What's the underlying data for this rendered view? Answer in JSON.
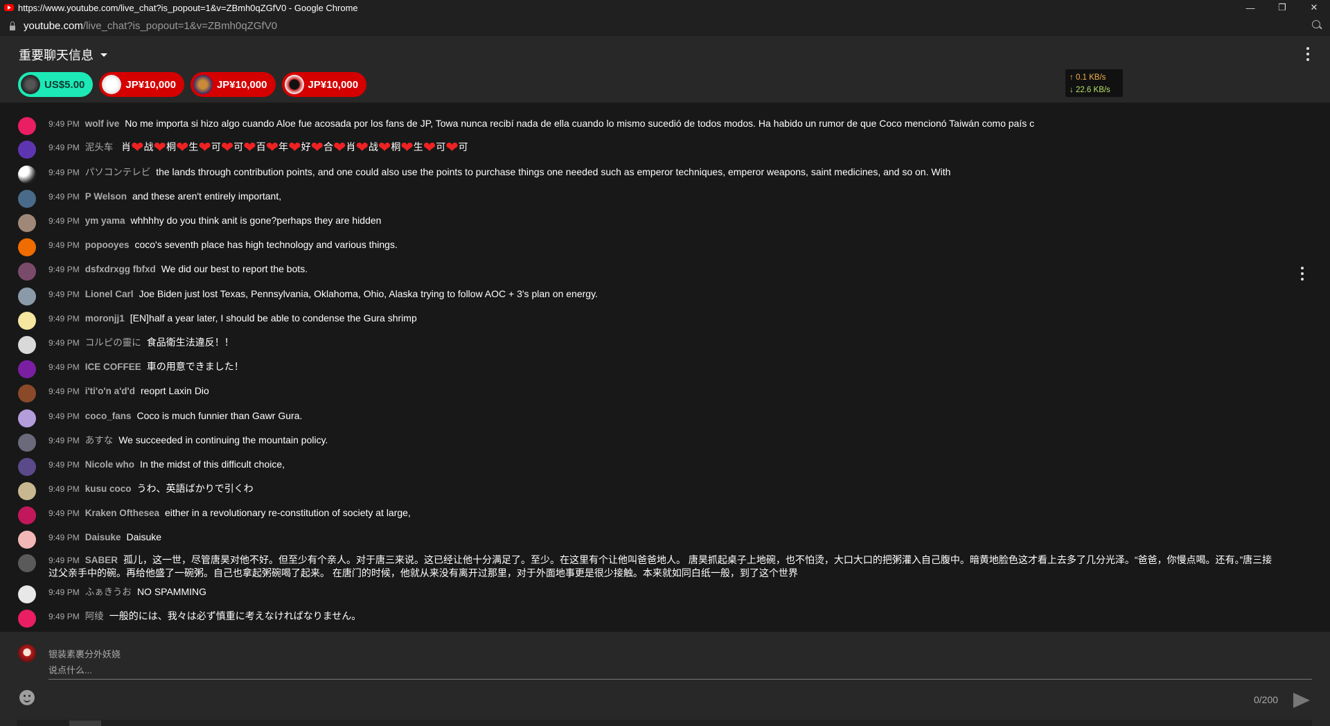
{
  "window": {
    "title": "https://www.youtube.com/live_chat?is_popout=1&v=ZBmh0qZGfV0 - Google Chrome",
    "url_host": "youtube.com",
    "url_path": "/live_chat?is_popout=1&v=ZBmh0qZGfV0",
    "controls": {
      "minimize": "—",
      "restore": "❐",
      "close": "✕"
    }
  },
  "network": {
    "up": "↑ 0.1 KB/s",
    "down": "↓ 22.6 KB/s"
  },
  "header": {
    "title": "重要聊天信息"
  },
  "tickers": [
    {
      "amount": "US$5.00",
      "color": "#1de9b6"
    },
    {
      "amount": "JP¥10,000",
      "color": "#d50000"
    },
    {
      "amount": "JP¥10,000",
      "color": "#d50000"
    },
    {
      "amount": "JP¥10,000",
      "color": "#d50000"
    }
  ],
  "messages": [
    {
      "time": "9:49 PM",
      "author": "wolf ive",
      "text": "No me importa si hizo algo cuando Aloe fue acosada por los fans de JP, Towa nunca recibí nada de ella cuando lo mismo sucedió de todos modos. Ha habido un rumor de que Coco mencionó Taiwán como país c",
      "avatar_color": "#e91e63"
    },
    {
      "time": "9:49 PM",
      "author": "泥头车",
      "text_parts": [
        "肖",
        "战",
        "桐",
        "生",
        "可",
        "可",
        "百",
        "年",
        "好",
        "合",
        "肖",
        "战",
        "桐",
        "生",
        "可",
        "可"
      ],
      "avatar_color": "#5e35b1"
    },
    {
      "time": "9:49 PM",
      "author": "パソコンテレビ",
      "text": "the lands through contribution points, and one could also use the points to purchase things one needed such as emperor techniques, emperor weapons, saint medicines, and so on. With",
      "avatar_color": "#eeeeee"
    },
    {
      "time": "9:49 PM",
      "author": "P Welson",
      "text": "and these aren't entirely important,",
      "avatar_color": "#4a6a8a"
    },
    {
      "time": "9:49 PM",
      "author": "ym yama",
      "text": "whhhhy do you think anit is gone?perhaps they are hidden",
      "avatar_color": "#a08878"
    },
    {
      "time": "9:49 PM",
      "author": "popooyes",
      "text": "coco's seventh place has high technology and various things.",
      "avatar_color": "#ef6c00"
    },
    {
      "time": "9:49 PM",
      "author": "dsfxdrxgg fbfxd",
      "text": "We did our best to report the bots.",
      "avatar_color": "#7a4a6a"
    },
    {
      "time": "9:49 PM",
      "author": "Lionel Carl",
      "text": "Joe Biden just lost Texas, Pennsylvania, Oklahoma, Ohio, Alaska trying to follow AOC + 3's plan on energy.",
      "avatar_color": "#8a9aa8"
    },
    {
      "time": "9:49 PM",
      "author": "moronjj1",
      "text": "[EN]half a year later, I should be able to condense the Gura shrimp",
      "avatar_color": "#f5e6a0"
    },
    {
      "time": "9:49 PM",
      "author": "コルピの靈に",
      "text": "食品衛生法違反！！",
      "avatar_color": "#d9d9d9"
    },
    {
      "time": "9:49 PM",
      "author": "ICE COFFEE",
      "text": "車の用意できました！",
      "avatar_color": "#7b1fa2"
    },
    {
      "time": "9:49 PM",
      "author": "i'ti'o'n a'd'd",
      "text": "reoprt Laxin Dio",
      "avatar_color": "#8a4a2a"
    },
    {
      "time": "9:49 PM",
      "author": "coco_fans",
      "text": "Coco is much funnier than Gawr Gura.",
      "avatar_color": "#b39ddb"
    },
    {
      "time": "9:49 PM",
      "author": "あすな",
      "text": "We succeeded in continuing the mountain policy.",
      "avatar_color": "#6a6a7a"
    },
    {
      "time": "9:49 PM",
      "author": "Nicole who",
      "text": "In the midst of this difficult choice,",
      "avatar_color": "#5a4a8a"
    },
    {
      "time": "9:49 PM",
      "author": "kusu coco",
      "text": "うわ、英語ばかりで引くわ",
      "avatar_color": "#c8b890"
    },
    {
      "time": "9:49 PM",
      "author": "Kraken Ofthesea",
      "text": "either in a revolutionary re-constitution of society at large,",
      "avatar_color": "#c2185b"
    },
    {
      "time": "9:49 PM",
      "author": "Daisuke",
      "text": "Daisuke",
      "avatar_color": "#f2b8b8"
    },
    {
      "time": "9:49 PM",
      "author": "SABER",
      "text": "孤儿，这一世，尽管唐昊对他不好。但至少有个亲人。对于唐三来说。这已经让他十分满足了。至少。在这里有个让他叫爸爸地人。 唐昊抓起桌子上地碗，也不怕烫，大口大口的把粥灌入自己腹中。暗黄地脸色这才看上去多了几分光泽。“爸爸，你慢点喝。还有。”唐三接过父亲手中的碗。再给他盛了一碗粥。自己也拿起粥碗喝了起来。 在唐门的时候，他就从来没有离开过那里，对于外面地事更是很少接触。本来就如同白纸一般，到了这个世界",
      "avatar_color": "#5a5a5a"
    },
    {
      "time": "9:49 PM",
      "author": "ふぁきうお",
      "text": "NO SPAMMING",
      "avatar_color": "#e8e8e8"
    },
    {
      "time": "9:49 PM",
      "author": "阿绫",
      "text": "一般的には、我々は必ず慎重に考えなければなりません。",
      "avatar_color": "#e91e63"
    }
  ],
  "input": {
    "username": "银装素裹分外妖娆",
    "placeholder": "说点什么...",
    "counter": "0/200"
  }
}
